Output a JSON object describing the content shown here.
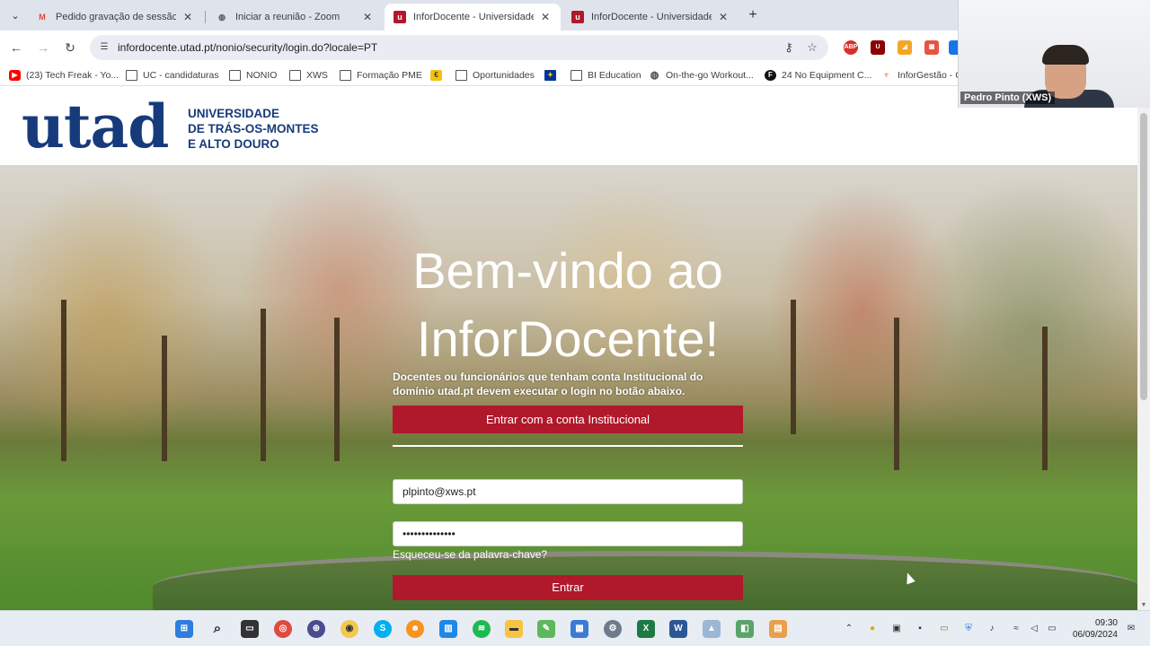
{
  "browser": {
    "tabs": [
      {
        "title": "Pedido gravação de sessão forma",
        "favicon": "gmail-icon",
        "active": false
      },
      {
        "title": "Iniciar a reunião - Zoom",
        "favicon": "globe-icon",
        "active": false
      },
      {
        "title": "InforDocente - Universidade de Trás",
        "favicon": "utad-icon",
        "active": true
      },
      {
        "title": "InforDocente - Universidade de Trás",
        "favicon": "utad-icon",
        "active": false
      }
    ],
    "url": "infordocente.utad.pt/nonio/security/login.do?locale=PT",
    "bookmarks": [
      {
        "label": "(23) Tech Freak - Yo...",
        "icon": "youtube-icon"
      },
      {
        "label": "UC - candidaturas",
        "icon": "folder-icon"
      },
      {
        "label": "NONIO",
        "icon": "folder-icon"
      },
      {
        "label": "XWS",
        "icon": "folder-icon"
      },
      {
        "label": "Formação PME",
        "icon": "folder-icon"
      },
      {
        "label": "",
        "icon": "bookmark-yellow-icon"
      },
      {
        "label": "Oportunidades",
        "icon": "folder-icon"
      },
      {
        "label": "",
        "icon": "eu-flag-icon"
      },
      {
        "label": "BI Education",
        "icon": "folder-icon"
      },
      {
        "label": "On-the-go Workout...",
        "icon": "globe-icon"
      },
      {
        "label": "24 No Equipment C...",
        "icon": "f-icon"
      },
      {
        "label": "InforGestão - C",
        "icon": "torch-icon"
      }
    ]
  },
  "page": {
    "logo": {
      "mark": "utad",
      "lines": [
        "UNIVERSIDADE",
        "DE TRÁS-OS-MONTES",
        "E ALTO DOURO"
      ]
    },
    "welcome": "Bem-vindo ao InforDocente!",
    "notice": "Docentes ou funcionários que tenham conta Institucional do domínio utad.pt devem executar o login no botão abaixo.",
    "institutional_button": "Entrar com a conta Institucional",
    "email_value": "plpinto@xws.pt",
    "password_value": "••••••••••••••",
    "forgot_link": "Esqueceu-se da palavra-chave?",
    "login_button": "Entrar"
  },
  "video_overlay": {
    "participant": "Pedro Pinto (XWS)"
  },
  "taskbar": {
    "time": "09:30",
    "date": "06/09/2024"
  },
  "colors": {
    "brand_blue": "#173b7a",
    "button_red": "#b0182b"
  }
}
